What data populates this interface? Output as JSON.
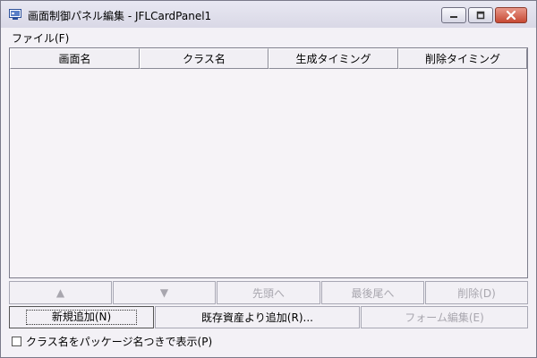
{
  "window": {
    "title": "画面制御パネル編集 - JFLCardPanel1"
  },
  "menu": {
    "items": [
      {
        "label": "ファイル(F)"
      }
    ]
  },
  "table": {
    "columns": [
      "画面名",
      "クラス名",
      "生成タイミング",
      "削除タイミング"
    ],
    "rows": []
  },
  "nav_buttons": {
    "up": "▲",
    "down": "▼",
    "first": "先頭へ",
    "last": "最後尾へ",
    "delete": "削除(D)"
  },
  "action_buttons": {
    "new": "新規追加(N)",
    "existing": "既存資産より追加(R)...",
    "form_edit": "フォーム編集(E)"
  },
  "options": {
    "show_package_label": "クラス名をパッケージ名つきで表示(P)",
    "show_package_checked": false
  }
}
